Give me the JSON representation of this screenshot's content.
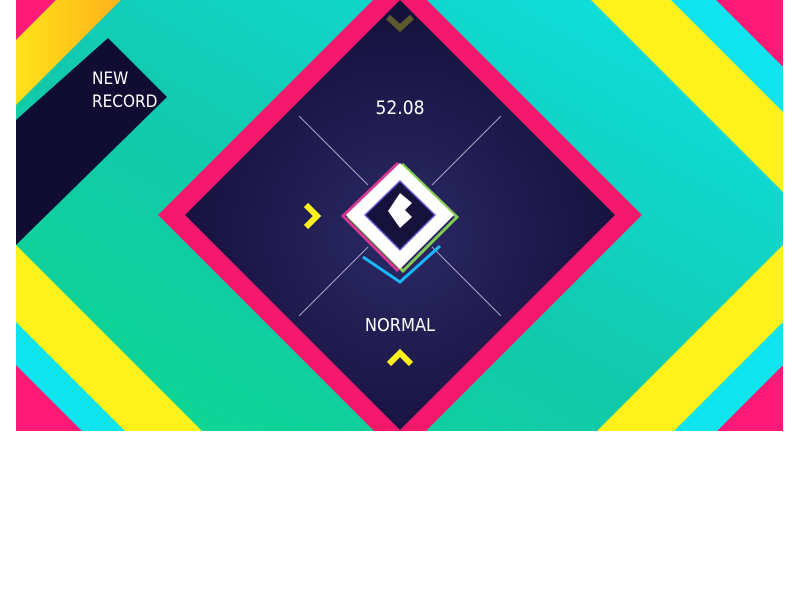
{
  "badge": {
    "line1": "NEW",
    "line2": "RECORD"
  },
  "score": "52.08",
  "difficulty": "NORMAL",
  "icons": {
    "up": "chevron-up-icon",
    "down": "chevron-down-icon",
    "left": "chevron-right-icon",
    "center": "back-arrow-icon"
  },
  "colors": {
    "teal": "#12c9ad",
    "cyan": "#0fe2e2",
    "green": "#0fd88f",
    "yellow": "#fff21a",
    "orange": "#ffb51a",
    "magenta": "#ff1a78",
    "navy": "#1b1646",
    "frame": "#f5196e",
    "accent_blue": "#1ab8ff"
  }
}
